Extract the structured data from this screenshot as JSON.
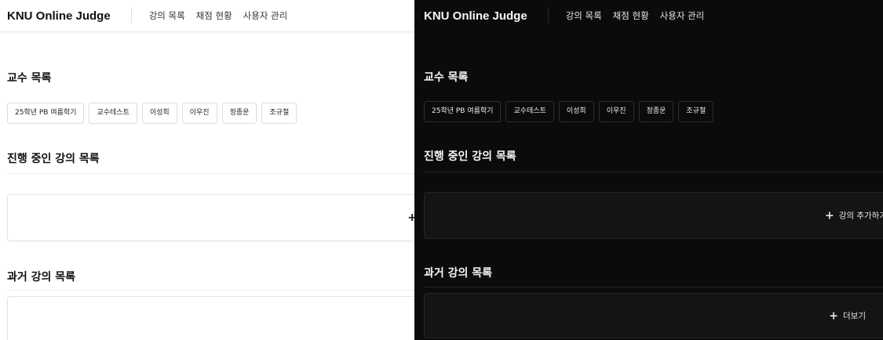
{
  "light": {
    "brand": "KNU Online Judge",
    "nav": [
      "강의 목록",
      "채점 현황",
      "사용자 관리"
    ],
    "professors_title": "교수 목록",
    "professors": [
      "25학년 PB 여름학기",
      "교수테스트",
      "이성희",
      "이우진",
      "정종운",
      "조규철"
    ],
    "ongoing_title": "진행 중인 강의 목록",
    "add_icon": "+",
    "past_title": "과거 강의 목록"
  },
  "dark": {
    "brand": "KNU Online Judge",
    "nav": [
      "강의 목록",
      "채점 현황",
      "사용자 관리"
    ],
    "professors_title": "교수 목록",
    "professors": [
      "25학년 PB 여름학기",
      "교수테스트",
      "이성희",
      "이우진",
      "정종운",
      "조규철"
    ],
    "ongoing_title": "진행 중인 강의 목록",
    "add_icon": "+",
    "add_label": "강의 추가하기",
    "past_title": "과거 강의 목록",
    "more_icon": "+",
    "more_label": "더보기"
  }
}
